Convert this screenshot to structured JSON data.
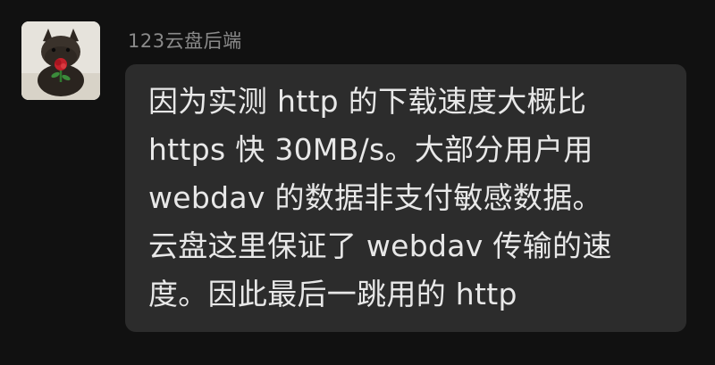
{
  "message": {
    "sender_name": "123云盘后端",
    "avatar_icon": "dog-with-rose-avatar",
    "lines": [
      "因为实测 http 的下载速度大概比",
      "https 快 30MB/s。大部分用户用",
      "webdav 的数据非支付敏感数据。",
      "云盘这里保证了 webdav 传输的速",
      "度。因此最后一跳用的 http"
    ]
  },
  "colors": {
    "background": "#111111",
    "bubble": "#2c2c2c",
    "text": "#e8e8e8",
    "sender_name": "#8a8a8a"
  }
}
